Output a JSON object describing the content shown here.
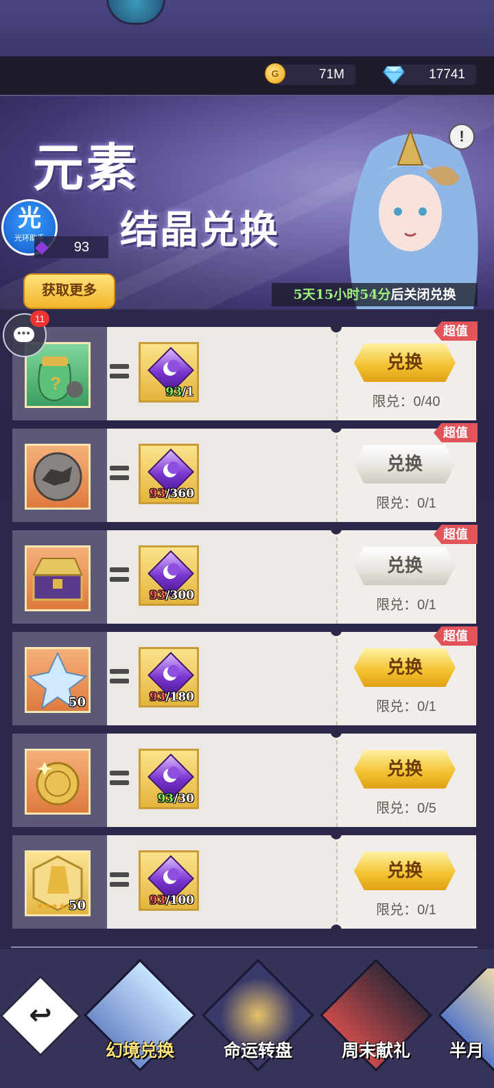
{
  "currency": {
    "gold": "71M",
    "diamond": "17741"
  },
  "banner": {
    "title_line1": "元素",
    "title_line2": "结晶兑换",
    "crystal_count": "93",
    "helper_big": "光",
    "helper_small": "光环助手",
    "get_more": "获取更多",
    "countdown_time": "5天15小时54分",
    "countdown_suffix": "后关闭兑换",
    "info": "!"
  },
  "chat_badge": "11",
  "rows": [
    {
      "cost_have": "93",
      "cost_need": "/1",
      "button": "兑换",
      "limit": "限兑：0/40",
      "tag": "超值",
      "item_qty": ""
    },
    {
      "cost_have": "93",
      "cost_need": "/360",
      "button": "兑换",
      "limit": "限兑：0/1",
      "tag": "超值",
      "item_qty": ""
    },
    {
      "cost_have": "93",
      "cost_need": "/300",
      "button": "兑换",
      "limit": "限兑：0/1",
      "tag": "超值",
      "item_qty": ""
    },
    {
      "cost_have": "93",
      "cost_need": "/180",
      "button": "兑换",
      "limit": "限兑：0/1",
      "tag": "超值",
      "item_qty": "50"
    },
    {
      "cost_have": "93",
      "cost_need": "/30",
      "button": "兑换",
      "limit": "限兑：0/5",
      "tag": "",
      "item_qty": ""
    },
    {
      "cost_have": "93",
      "cost_need": "/100",
      "button": "兑换",
      "limit": "限兑：0/1",
      "tag": "",
      "item_qty": "50"
    }
  ],
  "tabs": [
    "幻境兑换",
    "命运转盘",
    "周末献礼",
    "半月"
  ]
}
